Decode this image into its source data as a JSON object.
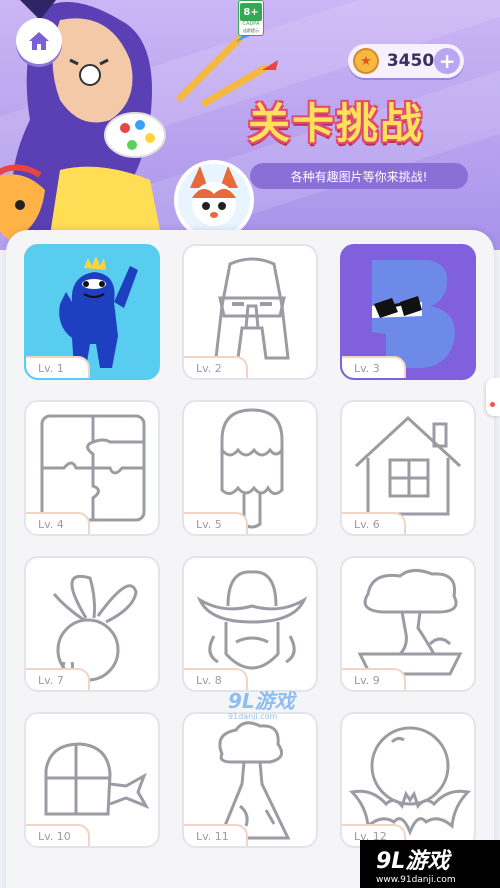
{
  "header": {
    "age_rating": "8+",
    "age_rating_org": "CADPA",
    "age_rating_note": "适龄提示",
    "coins": "3450",
    "title": "关卡挑战",
    "subtitle": "各种有趣图片等你来挑战!"
  },
  "icons": {
    "home": "home-icon",
    "coin": "star-coin-icon",
    "add": "plus-icon"
  },
  "levels": [
    {
      "label": "Lv. 1",
      "picture": "blue-monster",
      "state": "colored"
    },
    {
      "label": "Lv. 2",
      "picture": "letter-a-character",
      "state": "outline"
    },
    {
      "label": "Lv. 3",
      "picture": "letter-b-character",
      "state": "colored"
    },
    {
      "label": "Lv. 4",
      "picture": "jigsaw-puzzle",
      "state": "outline"
    },
    {
      "label": "Lv. 5",
      "picture": "popsicle",
      "state": "outline"
    },
    {
      "label": "Lv. 6",
      "picture": "house",
      "state": "outline"
    },
    {
      "label": "Lv. 7",
      "picture": "turnip",
      "state": "outline"
    },
    {
      "label": "Lv. 8",
      "picture": "cowboy",
      "state": "outline"
    },
    {
      "label": "Lv. 9",
      "picture": "bonsai-tree",
      "state": "outline"
    },
    {
      "label": "Lv. 10",
      "picture": "sushi",
      "state": "outline"
    },
    {
      "label": "Lv. 11",
      "picture": "volcano",
      "state": "outline"
    },
    {
      "label": "Lv. 12",
      "picture": "bat-moon",
      "state": "outline"
    }
  ],
  "watermarks": {
    "center_brand": "9L游戏",
    "center_url": "91danji.com",
    "corner_brand": "9L游戏",
    "corner_url": "www.91danji.com"
  },
  "colors": {
    "banner": "#b9a3ef",
    "title_fill": "#ffe25a",
    "title_stroke": "#e24a73",
    "level1_bg": "#59cdf0",
    "level3_bg": "#8060dc",
    "outline": "#9b9ba3"
  }
}
